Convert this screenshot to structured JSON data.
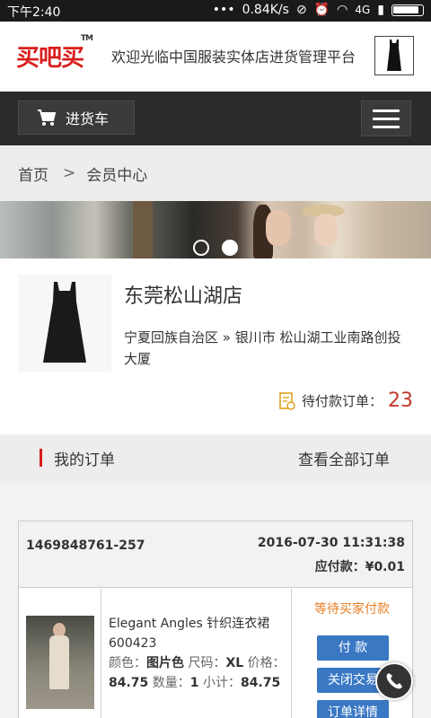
{
  "status_bar": {
    "time": "下午2:40",
    "network_speed": "0.84K/s",
    "network_type": "4G"
  },
  "header": {
    "logo_text": "买吧买",
    "trademark": "TM",
    "welcome": "欢迎光临中国服装实体店进货管理平台"
  },
  "navbar": {
    "cart_label": "进货车"
  },
  "breadcrumb": {
    "home": "首页",
    "separator": ">",
    "current": "会员中心"
  },
  "banner": {
    "slide_count": 2,
    "active_slide": 2
  },
  "store": {
    "name": "东莞松山湖店",
    "address": "宁夏回族自治区 » 银川市 松山湖工业南路创投大厦",
    "pending_label": "待付款订单：",
    "pending_count": "23"
  },
  "orders_section": {
    "title": "我的订单",
    "view_all": "查看全部订单"
  },
  "order": {
    "id": "1469848761-257",
    "datetime": "2016-07-30 11:31:38",
    "amount_due": "应付款：¥0.01",
    "product_name": "Elegant Angles 针织连衣裙 600423",
    "color_label": "颜色：",
    "color_value": "图片色",
    "size_label": " 尺码：",
    "size_value": "XL",
    "price_label": " 价格：",
    "price_value": "84.75",
    "qty_label": " 数量：",
    "qty_value": "1",
    "qty_unit": " 小计：",
    "subtotal_value": "84.75",
    "status": "等待买家付款",
    "pay_button": "付 款",
    "close_button": "关闭交易",
    "detail_button": "订单详情"
  },
  "icons": {
    "cart": "cart-icon",
    "menu": "menu-icon",
    "phone": "phone-icon",
    "order_list": "order-list-icon"
  },
  "colors": {
    "brand_red": "#d81e1e",
    "nav_dark": "#2b2b2b",
    "button_blue": "#3a78c4",
    "status_orange": "#e67e22",
    "pending_red": "#c0392b"
  }
}
